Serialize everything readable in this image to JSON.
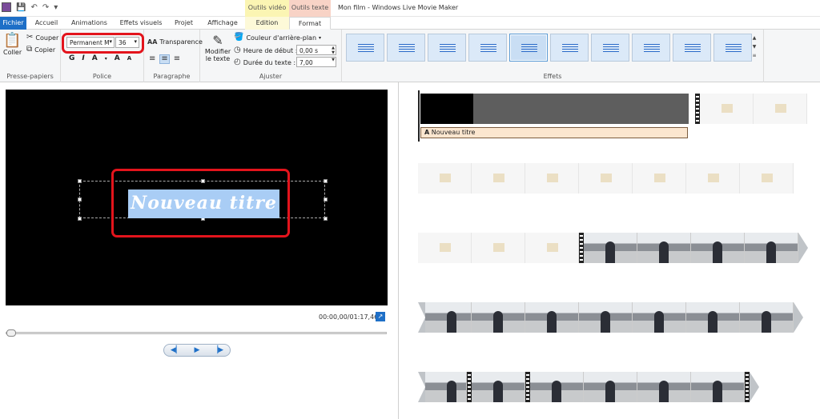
{
  "window": {
    "title": "Mon film - Windows Live Movie Maker"
  },
  "context_tabs": {
    "video_tools": "Outils vidéo",
    "text_tools": "Outils texte"
  },
  "tabs": [
    {
      "label": "Fichier"
    },
    {
      "label": "Accueil"
    },
    {
      "label": "Animations"
    },
    {
      "label": "Effets visuels"
    },
    {
      "label": "Projet"
    },
    {
      "label": "Affichage"
    },
    {
      "label": "Edition"
    },
    {
      "label": "Format"
    }
  ],
  "ribbon": {
    "clipboard": {
      "paste": "Coller",
      "cut": "Couper",
      "copy": "Copier",
      "label": "Presse-papiers"
    },
    "font": {
      "family": "Permanent M",
      "size": "36",
      "bold": "G",
      "italic": "I",
      "color": "A",
      "grow": "A",
      "shrink": "A",
      "label": "Police"
    },
    "paragraph": {
      "transparency": "Transparence",
      "label": "Paragraphe"
    },
    "adjust": {
      "edit_text": "Modifier le texte",
      "bg_color": "Couleur d'arrière-plan",
      "start_time_label": "Heure de début :",
      "start_time_value": "0,00 s",
      "duration_label": "Durée du texte :",
      "duration_value": "7,00",
      "label": "Ajuster"
    },
    "effects": {
      "label": "Effets"
    }
  },
  "preview": {
    "title_text": "Nouveau titre",
    "timecode": "00:00,00/01:17,46"
  },
  "storyboard": {
    "caption": "Nouveau titre"
  },
  "colors": {
    "accent": "#1e6fc7",
    "highlight": "#e3141c",
    "selection": "#a9cdf5"
  }
}
